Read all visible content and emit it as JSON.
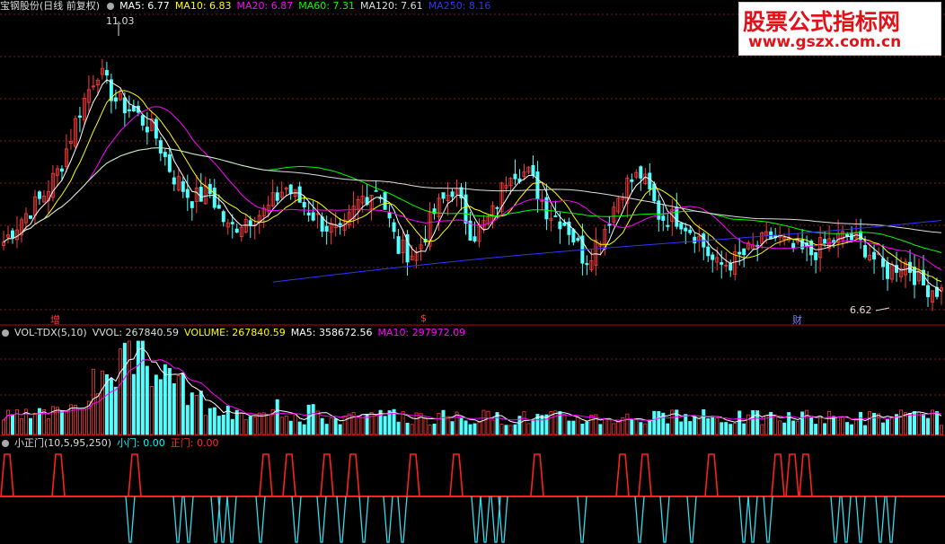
{
  "main_header": {
    "title": "宝钢股份(日线 前复权)",
    "items": [
      {
        "label": "MA5: 6.77",
        "color": "#ffffff"
      },
      {
        "label": "MA10: 6.83",
        "color": "#ffff00"
      },
      {
        "label": "MA20: 6.87",
        "color": "#ff00ff"
      },
      {
        "label": "MA60: 7.31",
        "color": "#00ff00"
      },
      {
        "label": "MA120: 7.61",
        "color": "#dddddd"
      },
      {
        "label": "MA250: 8.16",
        "color": "#3333ff"
      }
    ]
  },
  "annotations": {
    "high_label": "11.03",
    "low_label": "6.62",
    "marker_1": "增",
    "marker_2": "$",
    "marker_3": "财"
  },
  "vol_header": {
    "title": "VOL-TDX(5,10)",
    "items": [
      {
        "label": "VVOL: 267840.59",
        "color": "#dddddd"
      },
      {
        "label": "VOLUME: 267840.59",
        "color": "#ffff00"
      },
      {
        "label": "MA5: 358672.56",
        "color": "#ffffff"
      },
      {
        "label": "MA10: 297972.09",
        "color": "#ff00ff"
      }
    ]
  },
  "ind_header": {
    "title": "小正门(10,5,95,250)",
    "items": [
      {
        "label": "小门: 0.00",
        "color": "#00ffff"
      },
      {
        "label": "正门: 0.00",
        "color": "#ff0000"
      }
    ]
  },
  "watermark": {
    "line1": "股票公式指标网",
    "line2": "www.gszx.com.cn"
  },
  "colors": {
    "up": "#ff3c3c",
    "down": "#54ffff",
    "background": "#000000",
    "grid": "#7a1c1c",
    "separator": "#c00000"
  },
  "chart_data": [
    {
      "type": "candlestick",
      "title": "宝钢股份(日线 前复权)",
      "ylim": [
        6.4,
        11.2
      ],
      "high": 11.03,
      "low": 6.62,
      "series": [
        {
          "name": "MA5",
          "last": 6.77
        },
        {
          "name": "MA10",
          "last": 6.83
        },
        {
          "name": "MA20",
          "last": 6.87
        },
        {
          "name": "MA60",
          "last": 7.31
        },
        {
          "name": "MA120",
          "last": 7.61
        },
        {
          "name": "MA250",
          "last": 8.16
        }
      ],
      "close_path": [
        7.5,
        7.9,
        8.2,
        8.7,
        9.6,
        10.3,
        9.8,
        9.6,
        9.3,
        8.6,
        8.2,
        8.3,
        7.7,
        7.9,
        8.0,
        8.4,
        8.1,
        7.8,
        7.6,
        8.2,
        8.4,
        7.4,
        7.3,
        8.0,
        8.4,
        7.6,
        7.9,
        8.7,
        8.6,
        8.0,
        7.8,
        7.2,
        7.7,
        8.4,
        8.6,
        7.9,
        7.9,
        7.6,
        7.1,
        7.2,
        7.4,
        7.6,
        7.4,
        7.3,
        7.5,
        7.6,
        7.4,
        7.0,
        7.2,
        6.8,
        6.7
      ]
    },
    {
      "type": "bar",
      "title": "VOL-TDX(5,10)",
      "series": [
        {
          "name": "VVOL",
          "last": 267840.59
        },
        {
          "name": "VOLUME",
          "last": 267840.59
        },
        {
          "name": "MA5",
          "last": 358672.56
        },
        {
          "name": "MA10",
          "last": 297972.09
        }
      ]
    },
    {
      "type": "line",
      "title": "小正门(10,5,95,250)",
      "series": [
        {
          "name": "小门",
          "last": 0.0
        },
        {
          "name": "正门",
          "last": 0.0
        }
      ]
    }
  ]
}
